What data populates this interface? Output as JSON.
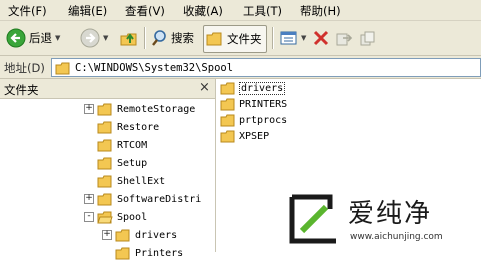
{
  "menu": [
    "文件(F)",
    "编辑(E)",
    "查看(V)",
    "收藏(A)",
    "工具(T)",
    "帮助(H)"
  ],
  "toolbar": {
    "back_label": "后退",
    "search_label": "搜索",
    "folders_label": "文件夹"
  },
  "address": {
    "label": "地址(D)",
    "path": "C:\\WINDOWS\\System32\\Spool"
  },
  "folders_pane": {
    "title": "文件夹",
    "close": "×",
    "tree": [
      {
        "label": "RemoteStorage",
        "expander": "+"
      },
      {
        "label": "Restore",
        "expander": ""
      },
      {
        "label": "RTCOM",
        "expander": ""
      },
      {
        "label": "Setup",
        "expander": ""
      },
      {
        "label": "ShellExt",
        "expander": ""
      },
      {
        "label": "SoftwareDistri",
        "expander": "+"
      },
      {
        "label": "Spool",
        "expander": "-"
      },
      {
        "label": "drivers",
        "expander": "+"
      },
      {
        "label": "Printers",
        "expander": ""
      }
    ]
  },
  "contents": [
    {
      "label": "drivers",
      "selected": true
    },
    {
      "label": "PRINTERS",
      "selected": false
    },
    {
      "label": "prtprocs",
      "selected": false
    },
    {
      "label": "XPSEP",
      "selected": false
    }
  ],
  "watermark": {
    "brand": "爱纯净",
    "url": "www.aichunjing.com"
  }
}
